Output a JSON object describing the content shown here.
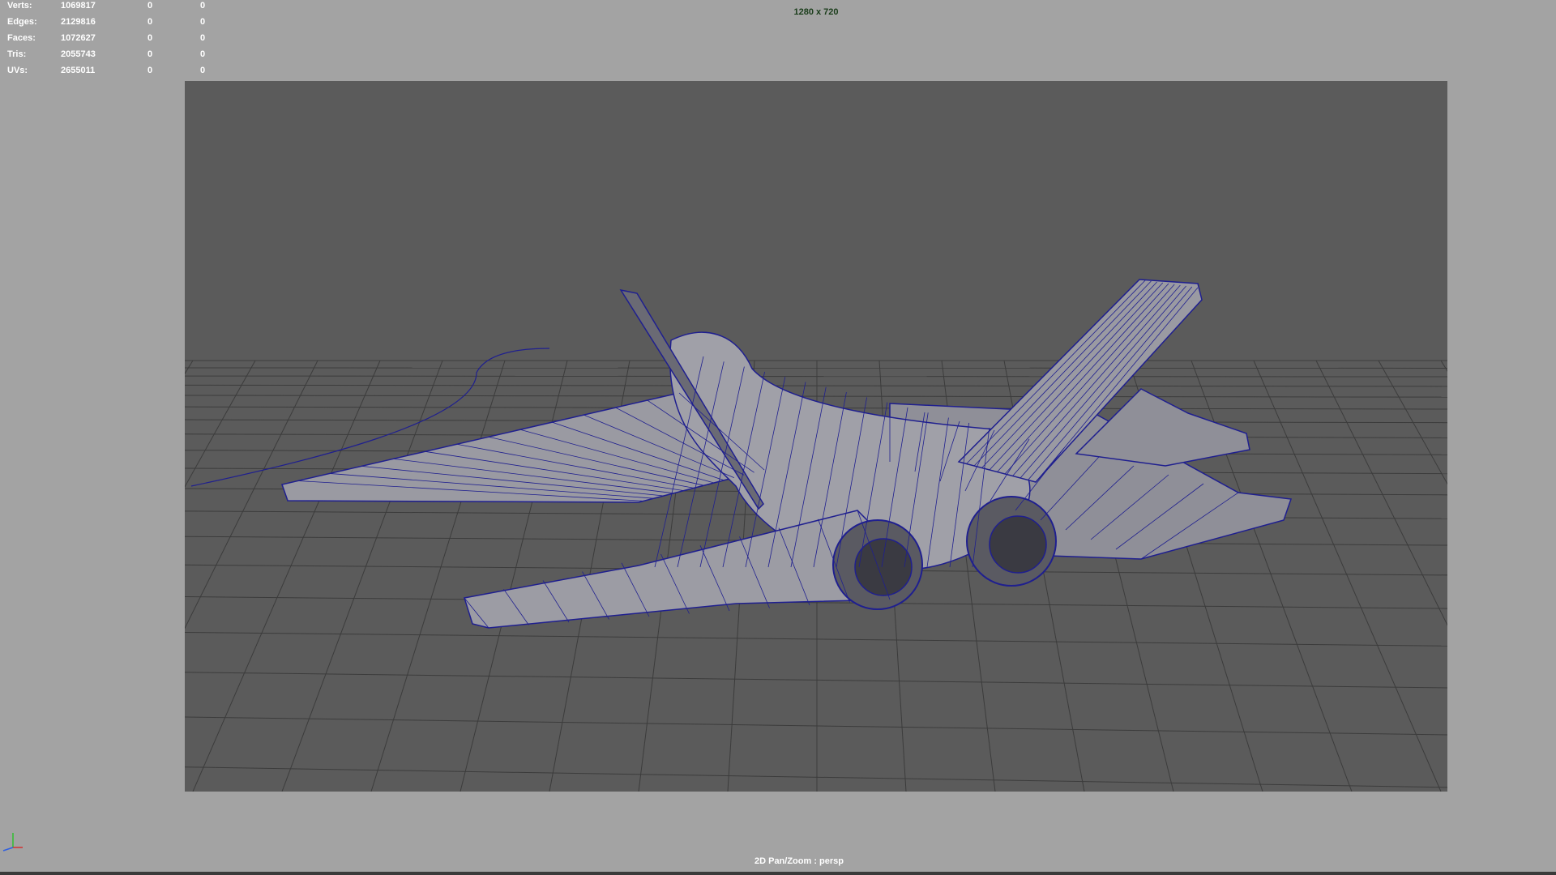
{
  "hud": {
    "rows": [
      {
        "label": "Verts:",
        "count": "1069817",
        "selected": "0",
        "component": "0"
      },
      {
        "label": "Edges:",
        "count": "2129816",
        "selected": "0",
        "component": "0"
      },
      {
        "label": "Faces:",
        "count": "1072627",
        "selected": "0",
        "component": "0"
      },
      {
        "label": "Tris:",
        "count": "2055743",
        "selected": "0",
        "component": "0"
      },
      {
        "label": "UVs:",
        "count": "2655011",
        "selected": "0",
        "component": "0"
      }
    ]
  },
  "viewport": {
    "resolution": "1280 x 720",
    "camera_mode": "2D Pan/Zoom : persp",
    "background_color": "#a3a3a3",
    "gate_color": "#5b5b5b",
    "wire_color": "#1f1f8f",
    "model_color": "#9a9aa2",
    "grid_color": "#3c3c3c"
  },
  "gizmo": {
    "axes": [
      {
        "axis": "y",
        "color": "#2fbf2f"
      },
      {
        "axis": "x",
        "color": "#d23232"
      },
      {
        "axis": "z",
        "color": "#3060e0"
      }
    ]
  }
}
